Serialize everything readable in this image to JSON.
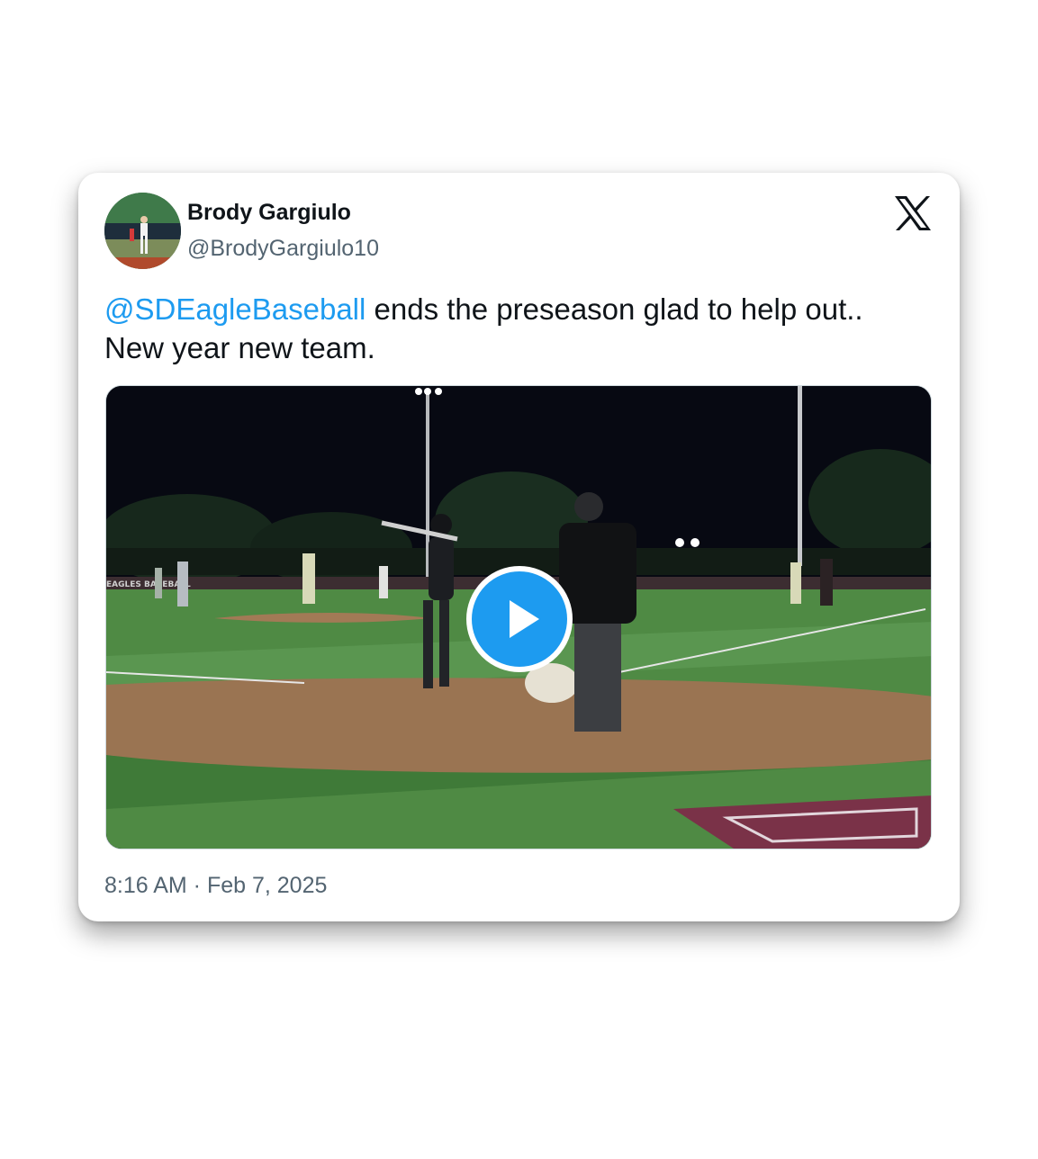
{
  "author": {
    "name": "Brody Gargiulo",
    "handle": "@BrodyGargiulo10"
  },
  "platform_icon": "x-logo-icon",
  "tweet": {
    "mention": "@SDEagleBaseball",
    "text_line1": " ends the preseason glad to help out..",
    "text_line2": "New year new team."
  },
  "media": {
    "type": "video",
    "play_icon": "play-icon",
    "scoreboard_text": "EAGLES BASEBALL"
  },
  "timestamp": "8:16 AM · Feb 7, 2025",
  "colors": {
    "link": "#1d9bf0",
    "text": "#0f1419",
    "secondary": "#536471"
  }
}
